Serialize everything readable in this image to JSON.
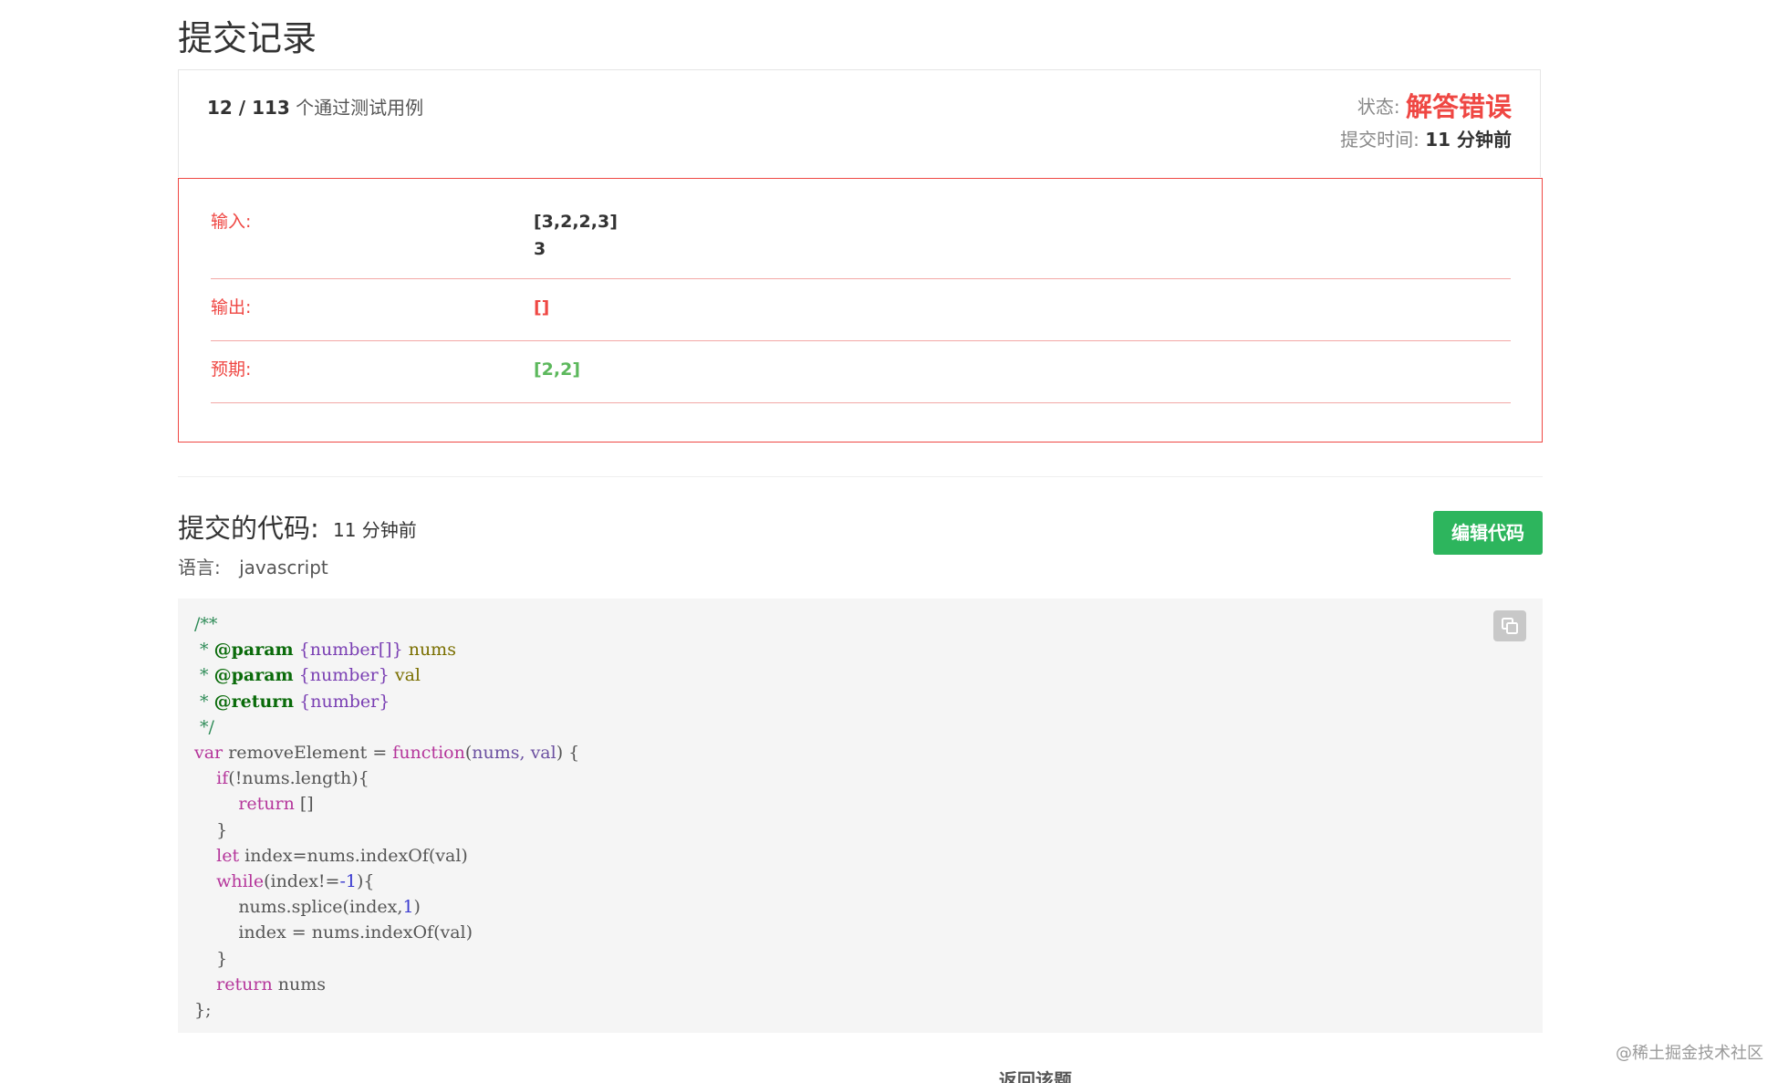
{
  "page": {
    "title": "提交记录"
  },
  "summary": {
    "passed": "12 / 113",
    "passed_suffix": "个通过测试用例",
    "status_label": "状态:",
    "status_value": "解答错误",
    "time_label": "提交时间:",
    "time_value": "11 分钟前"
  },
  "result": {
    "input_label": "输入:",
    "input_lines": [
      "[3,2,2,3]",
      "3"
    ],
    "output_label": "输出:",
    "output_value": "[]",
    "expected_label": "预期:",
    "expected_value": "[2,2]"
  },
  "code_section": {
    "heading": "提交的代码:",
    "time": "11 分钟前",
    "language_label": "语言:",
    "language": "javascript",
    "edit_button": "编辑代码",
    "copy_icon": "copy-icon"
  },
  "footer": {
    "back_link": "返回该题",
    "watermark": "@稀土掘金技术社区"
  },
  "colors": {
    "error": "#ef4743",
    "success": "#5cb85c",
    "button": "#2db55d"
  }
}
